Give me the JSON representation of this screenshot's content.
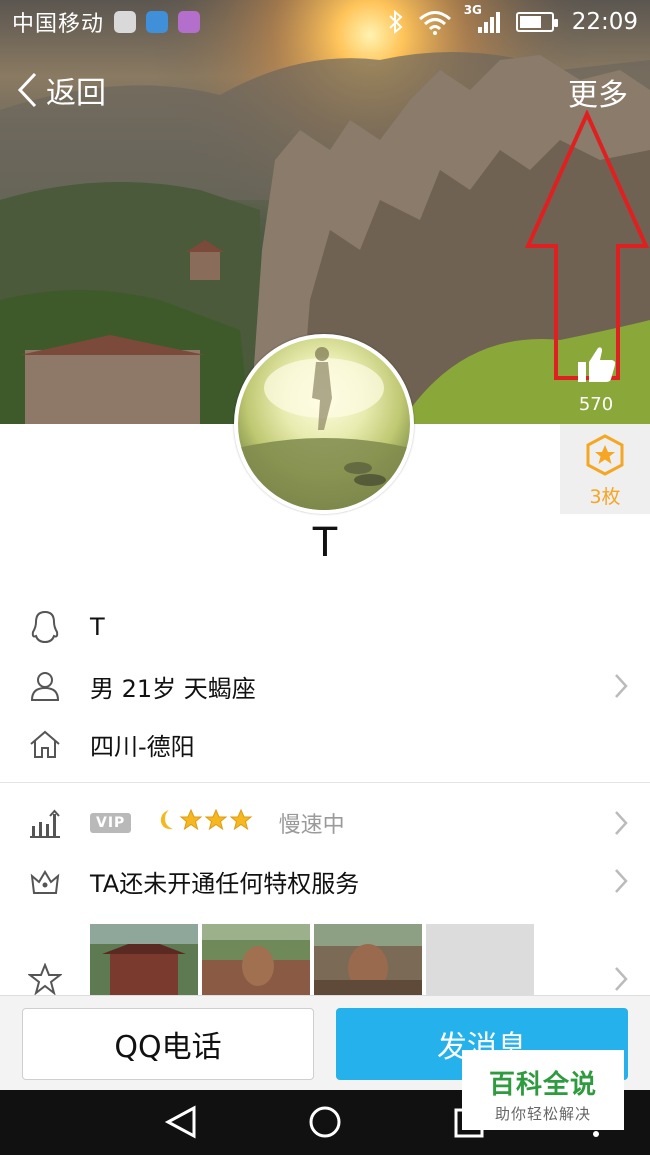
{
  "status_bar": {
    "carrier": "中国移动",
    "network": "3G",
    "time": "22:09",
    "battery_level": 0.7
  },
  "nav": {
    "back_label": "返回",
    "more_label": "更多"
  },
  "profile": {
    "likes": "570",
    "badge_count": "3枚",
    "nickname": "T"
  },
  "info": {
    "qq_name": "T",
    "basic": "男  21岁  天蝎座",
    "location": "四川-德阳",
    "vip_tag": "VIP",
    "vip_status": "慢速中",
    "privilege": "TA还未开通任何特权服务"
  },
  "actions": {
    "call_label": "QQ电话",
    "message_label": "发消息"
  },
  "watermark": {
    "title": "百科全说",
    "subtitle": "助你轻松解决"
  },
  "colors": {
    "accent": "#24b1ec",
    "badge": "#f5a623",
    "annotation": "#e02020"
  },
  "icons": {
    "back": "chevron-left-icon",
    "like": "thumbs-up-icon",
    "badge": "star-hexagon-icon",
    "qq": "penguin-icon",
    "person": "person-icon",
    "home": "home-icon",
    "level": "level-chart-icon",
    "privilege": "crown-icon",
    "space": "star-icon"
  }
}
